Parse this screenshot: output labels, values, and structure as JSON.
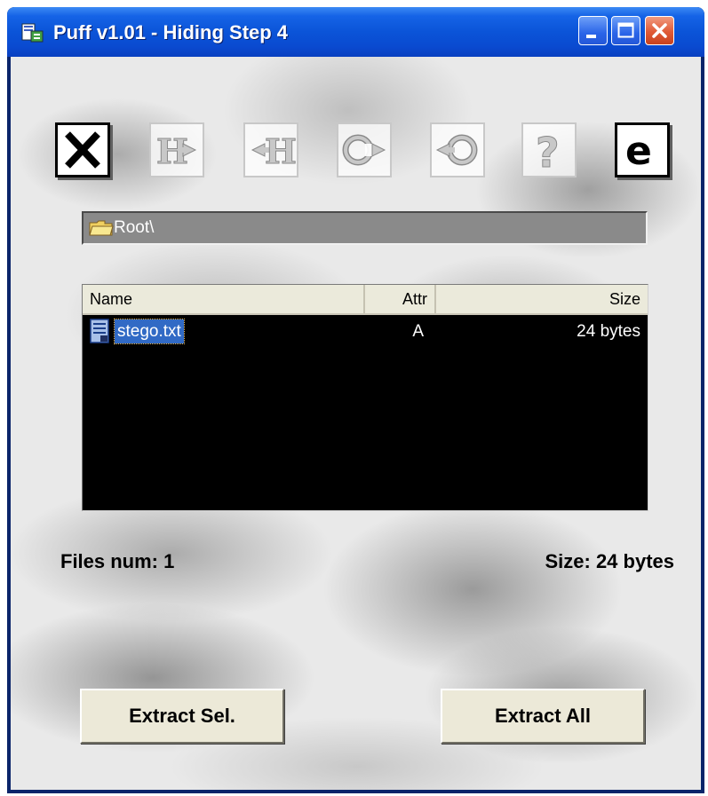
{
  "window": {
    "title": "Puff v1.01 - Hiding Step 4",
    "app_icon": "puff-app-icon"
  },
  "title_buttons": {
    "minimize_icon": "minimize-icon",
    "maximize_icon": "maximize-icon",
    "close_icon": "close-icon"
  },
  "toolbar": {
    "items": [
      {
        "name": "exit-icon",
        "glyph": "X",
        "enabled": true
      },
      {
        "name": "hide-icon",
        "glyph": "H→",
        "enabled": false
      },
      {
        "name": "unhide-icon",
        "glyph": "←H",
        "enabled": false
      },
      {
        "name": "copy-in-icon",
        "glyph": "C→",
        "enabled": false
      },
      {
        "name": "copy-out-icon",
        "glyph": "←C",
        "enabled": false
      },
      {
        "name": "help-icon",
        "glyph": "?",
        "enabled": false
      },
      {
        "name": "about-icon",
        "glyph": "e",
        "enabled": true
      }
    ]
  },
  "path": {
    "icon": "folder-icon",
    "text": "Root\\"
  },
  "file_list": {
    "columns": [
      "Name",
      "Attr",
      "Size"
    ],
    "rows": [
      {
        "icon": "file-icon",
        "name": "stego.txt",
        "attr": "A",
        "size": "24 bytes",
        "selected": true
      }
    ]
  },
  "status": {
    "files_num": "Files num: 1",
    "total_size": "Size: 24 bytes"
  },
  "actions": {
    "extract_selected": "Extract Sel.",
    "extract_all": "Extract All"
  },
  "colors": {
    "titlebar": "#0b54d8",
    "selection": "#316ac5",
    "list_background": "#000000",
    "button_face": "#ece9d8"
  }
}
